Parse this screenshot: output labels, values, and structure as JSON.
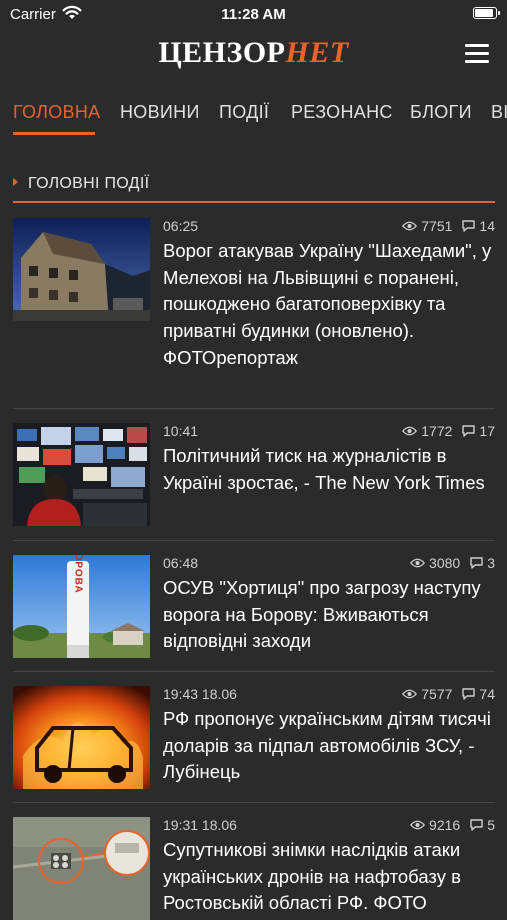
{
  "status_bar": {
    "carrier": "Carrier",
    "time": "11:28 AM"
  },
  "header": {
    "logo_part1": "ЦЕНЗОР",
    "logo_part2": "НЕТ"
  },
  "tabs": [
    {
      "label": "ГОЛОВНА",
      "active": true
    },
    {
      "label": "НОВИНИ"
    },
    {
      "label": "ПОДІЇ"
    },
    {
      "label": "РЕЗОНАНС"
    },
    {
      "label": "БЛОГИ"
    },
    {
      "label": "ВІ"
    }
  ],
  "section": {
    "title": "ГОЛОВНІ ПОДІЇ"
  },
  "articles": [
    {
      "time": "06:25",
      "views": "7751",
      "comments": "14",
      "title": "Ворог атакував Україну \"Шахедами\", у Мелехові на Львівщині є поранені, пошкоджено багатоповерхівку та приватні будинки (оновлено). ФОТОрепортаж"
    },
    {
      "time": "10:41",
      "views": "1772",
      "comments": "17",
      "title": "Політичний тиск на журналістів в Україні зростає, - The New York Times"
    },
    {
      "time": "06:48",
      "views": "3080",
      "comments": "3",
      "title": "ОСУВ \"Хортиця\" про загрозу наступу ворога на Борову: Вживаються відповідні заходи",
      "sign_text": "БОРОВА"
    },
    {
      "time": "19:43 18.06",
      "views": "7577",
      "comments": "74",
      "title": "РФ пропонує українським дітям тисячі доларів за підпал автомобілів ЗСУ, - Лубінець"
    },
    {
      "time": "19:31 18.06",
      "views": "9216",
      "comments": "5",
      "title": "Супутникові знімки наслідків атаки українських дронів на нафтобазу в Ростовській області РФ. ФОТО"
    }
  ],
  "colors": {
    "accent": "#e8622c",
    "background": "#2b2b2b"
  }
}
